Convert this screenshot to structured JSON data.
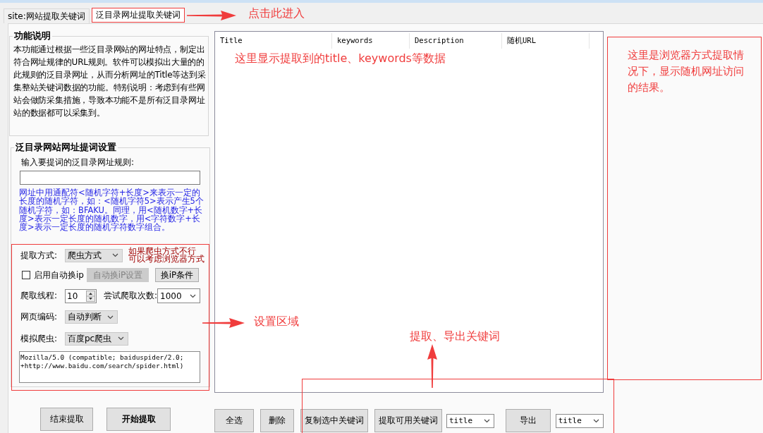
{
  "tabs": [
    {
      "label": "site:网站提取关键词",
      "selected": false
    },
    {
      "label": "泛目录网址提取关键词",
      "selected": true
    }
  ],
  "description": {
    "title": "功能说明",
    "text": "本功能通过根据一些泛目录网站的网址特点，制定出符合网址规律的URL规则。软件可以模拟出大量的的此规则的泛目录网址，从而分析网址的Title等达到采集整站关键词数据的功能。特别说明：考虑到有些网站会做防采集措施，导致本功能不是所有泛目录网址站的数据都可以采集到。"
  },
  "settings": {
    "title": "泛目录网站网址提词设置",
    "rule_label": "输入要提词的泛目录网址规则:",
    "rule_help": "网址中用通配符<随机字符+长度>来表示一定的长度的随机字符，如：<随机字符5>表示产生5个随机字符，如：BFAKU。同理，用<随机数字+长度>表示一定长度的随机数字，用<字符数字+长度>表示一定长度的随机字符数字组合。",
    "extract_mode": {
      "label": "提取方式:",
      "value": "爬虫方式"
    },
    "mode_note": [
      "如果爬虫方式不行",
      "可以考虑浏览器方式"
    ],
    "auto_ip": {
      "label": "启用自动换ip",
      "checked": false
    },
    "ip_buttons": [
      {
        "label": "自动换iP设置",
        "disabled": true
      },
      {
        "label": "换iP条件",
        "disabled": false
      }
    ],
    "threads": {
      "label": "爬取线程:",
      "value": "10"
    },
    "retries": {
      "label": "尝试爬取次数:",
      "value": "1000"
    },
    "encoding": {
      "label": "网页编码:",
      "value": "自动判断"
    },
    "spider": {
      "label": "模拟爬虫:",
      "value": "百度pc爬虫"
    },
    "user_agent": "Mozilla/5.0 (compatible; baiduspider/2.0;\n+http://www.baidu.com/search/spider.html)"
  },
  "left_buttons": [
    {
      "label": "结束提取",
      "bold": false
    },
    {
      "label": "开始提取",
      "bold": true
    }
  ],
  "results_table": {
    "columns": [
      "Title",
      "keywords",
      "Description",
      "随机URL"
    ]
  },
  "list_toolbar": [
    {
      "kind": "button",
      "label": "全选"
    },
    {
      "kind": "button",
      "label": "删除"
    },
    {
      "kind": "button",
      "label": "复制选中关键词"
    },
    {
      "kind": "button",
      "label": "提取可用关键词"
    },
    {
      "kind": "select",
      "value": "title"
    },
    {
      "kind": "button",
      "label": "导出"
    },
    {
      "kind": "select",
      "value": "title"
    }
  ],
  "annotations": [
    {
      "text": "点击此进入"
    },
    {
      "text": "这里显示提取到的title、keywords等数据"
    },
    {
      "text": "这里是浏览器方式提取情况下，显示随机网址访问的结果。"
    },
    {
      "text": "设置区域"
    },
    {
      "text": "提取、导出关键词"
    }
  ]
}
